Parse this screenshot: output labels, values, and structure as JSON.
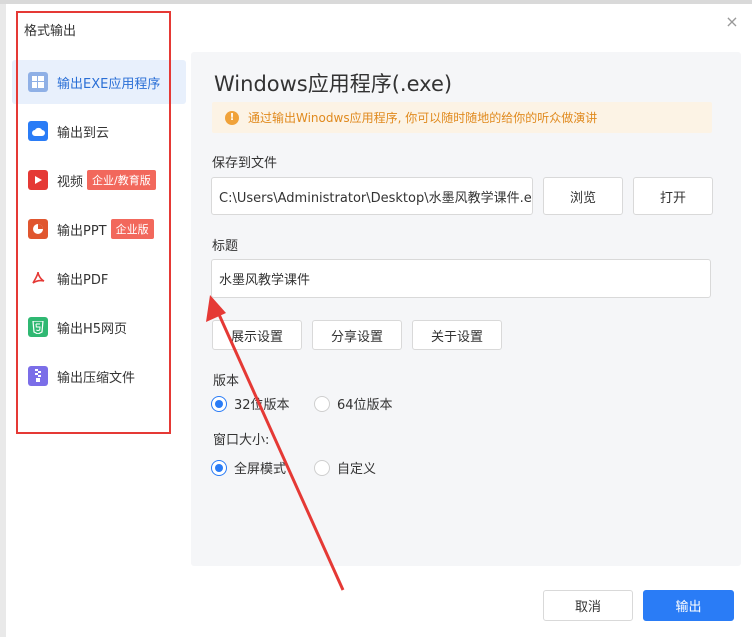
{
  "dialog": {
    "title": "格式输出",
    "close": "×"
  },
  "sidebar": {
    "items": [
      {
        "label": "输出EXE应用程序",
        "icon": "windows-icon",
        "badge": ""
      },
      {
        "label": "输出到云",
        "icon": "cloud-icon",
        "badge": ""
      },
      {
        "label": "视频",
        "icon": "video-icon",
        "badge": "企业/教育版"
      },
      {
        "label": "输出PPT",
        "icon": "ppt-icon",
        "badge": "企业版"
      },
      {
        "label": "输出PDF",
        "icon": "pdf-icon",
        "badge": ""
      },
      {
        "label": "输出H5网页",
        "icon": "html5-icon",
        "badge": ""
      },
      {
        "label": "输出压缩文件",
        "icon": "zip-icon",
        "badge": ""
      }
    ]
  },
  "panel": {
    "title": "Windows应用程序(.exe)",
    "notice": "通过输出Winodws应用程序, 你可以随时随地的给你的听众做演讲",
    "save_label": "保存到文件",
    "save_path": "C:\\Users\\Administrator\\Desktop\\水墨风教学课件.exe",
    "browse": "浏览",
    "open": "打开",
    "title_label": "标题",
    "title_value": "水墨风教学课件",
    "display_settings": "展示设置",
    "share_settings": "分享设置",
    "about_settings": "关于设置",
    "version_label": "版本",
    "version_32": "32位版本",
    "version_64": "64位版本",
    "window_label": "窗口大小:",
    "fullscreen": "全屏模式",
    "custom": "自定义"
  },
  "footer": {
    "cancel": "取消",
    "export": "输出"
  },
  "colors": {
    "accent": "#2a7cf6",
    "annotation": "#e53935",
    "badge": "#f2685c"
  }
}
